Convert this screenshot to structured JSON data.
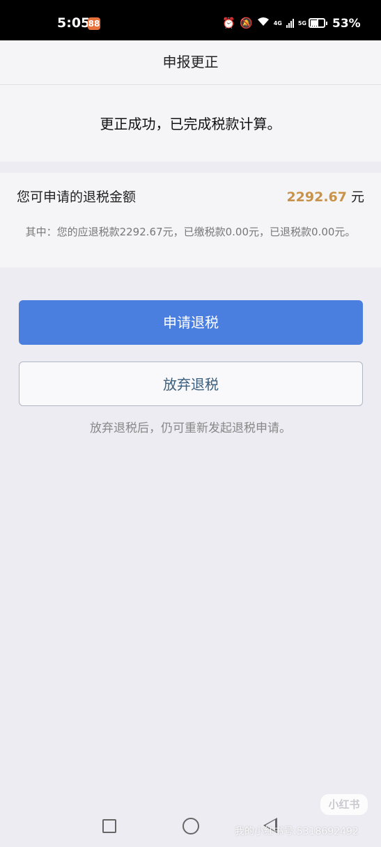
{
  "status_bar": {
    "time": "5:05",
    "app_badge": "88",
    "net1": "4G",
    "net2": "5G",
    "battery": "53%"
  },
  "header": {
    "title": "申报更正"
  },
  "result": {
    "message": "更正成功，已完成税款计算。"
  },
  "refund": {
    "label": "您可申请的退税金额",
    "amount": "2292.67",
    "unit": "元",
    "detail": "其中：您的应退税款2292.67元，已缴税款0.00元，已退税款0.00元。"
  },
  "actions": {
    "apply_label": "申请退税",
    "abandon_label": "放弃退税",
    "note": "放弃退税后，仍可重新发起退税申请。"
  },
  "watermark": {
    "logo": "小红书",
    "id_text": "我的小红书号:5318692492"
  },
  "colors": {
    "primary": "#4a7fe0",
    "amount": "#c8924a",
    "background": "#ececf2"
  }
}
